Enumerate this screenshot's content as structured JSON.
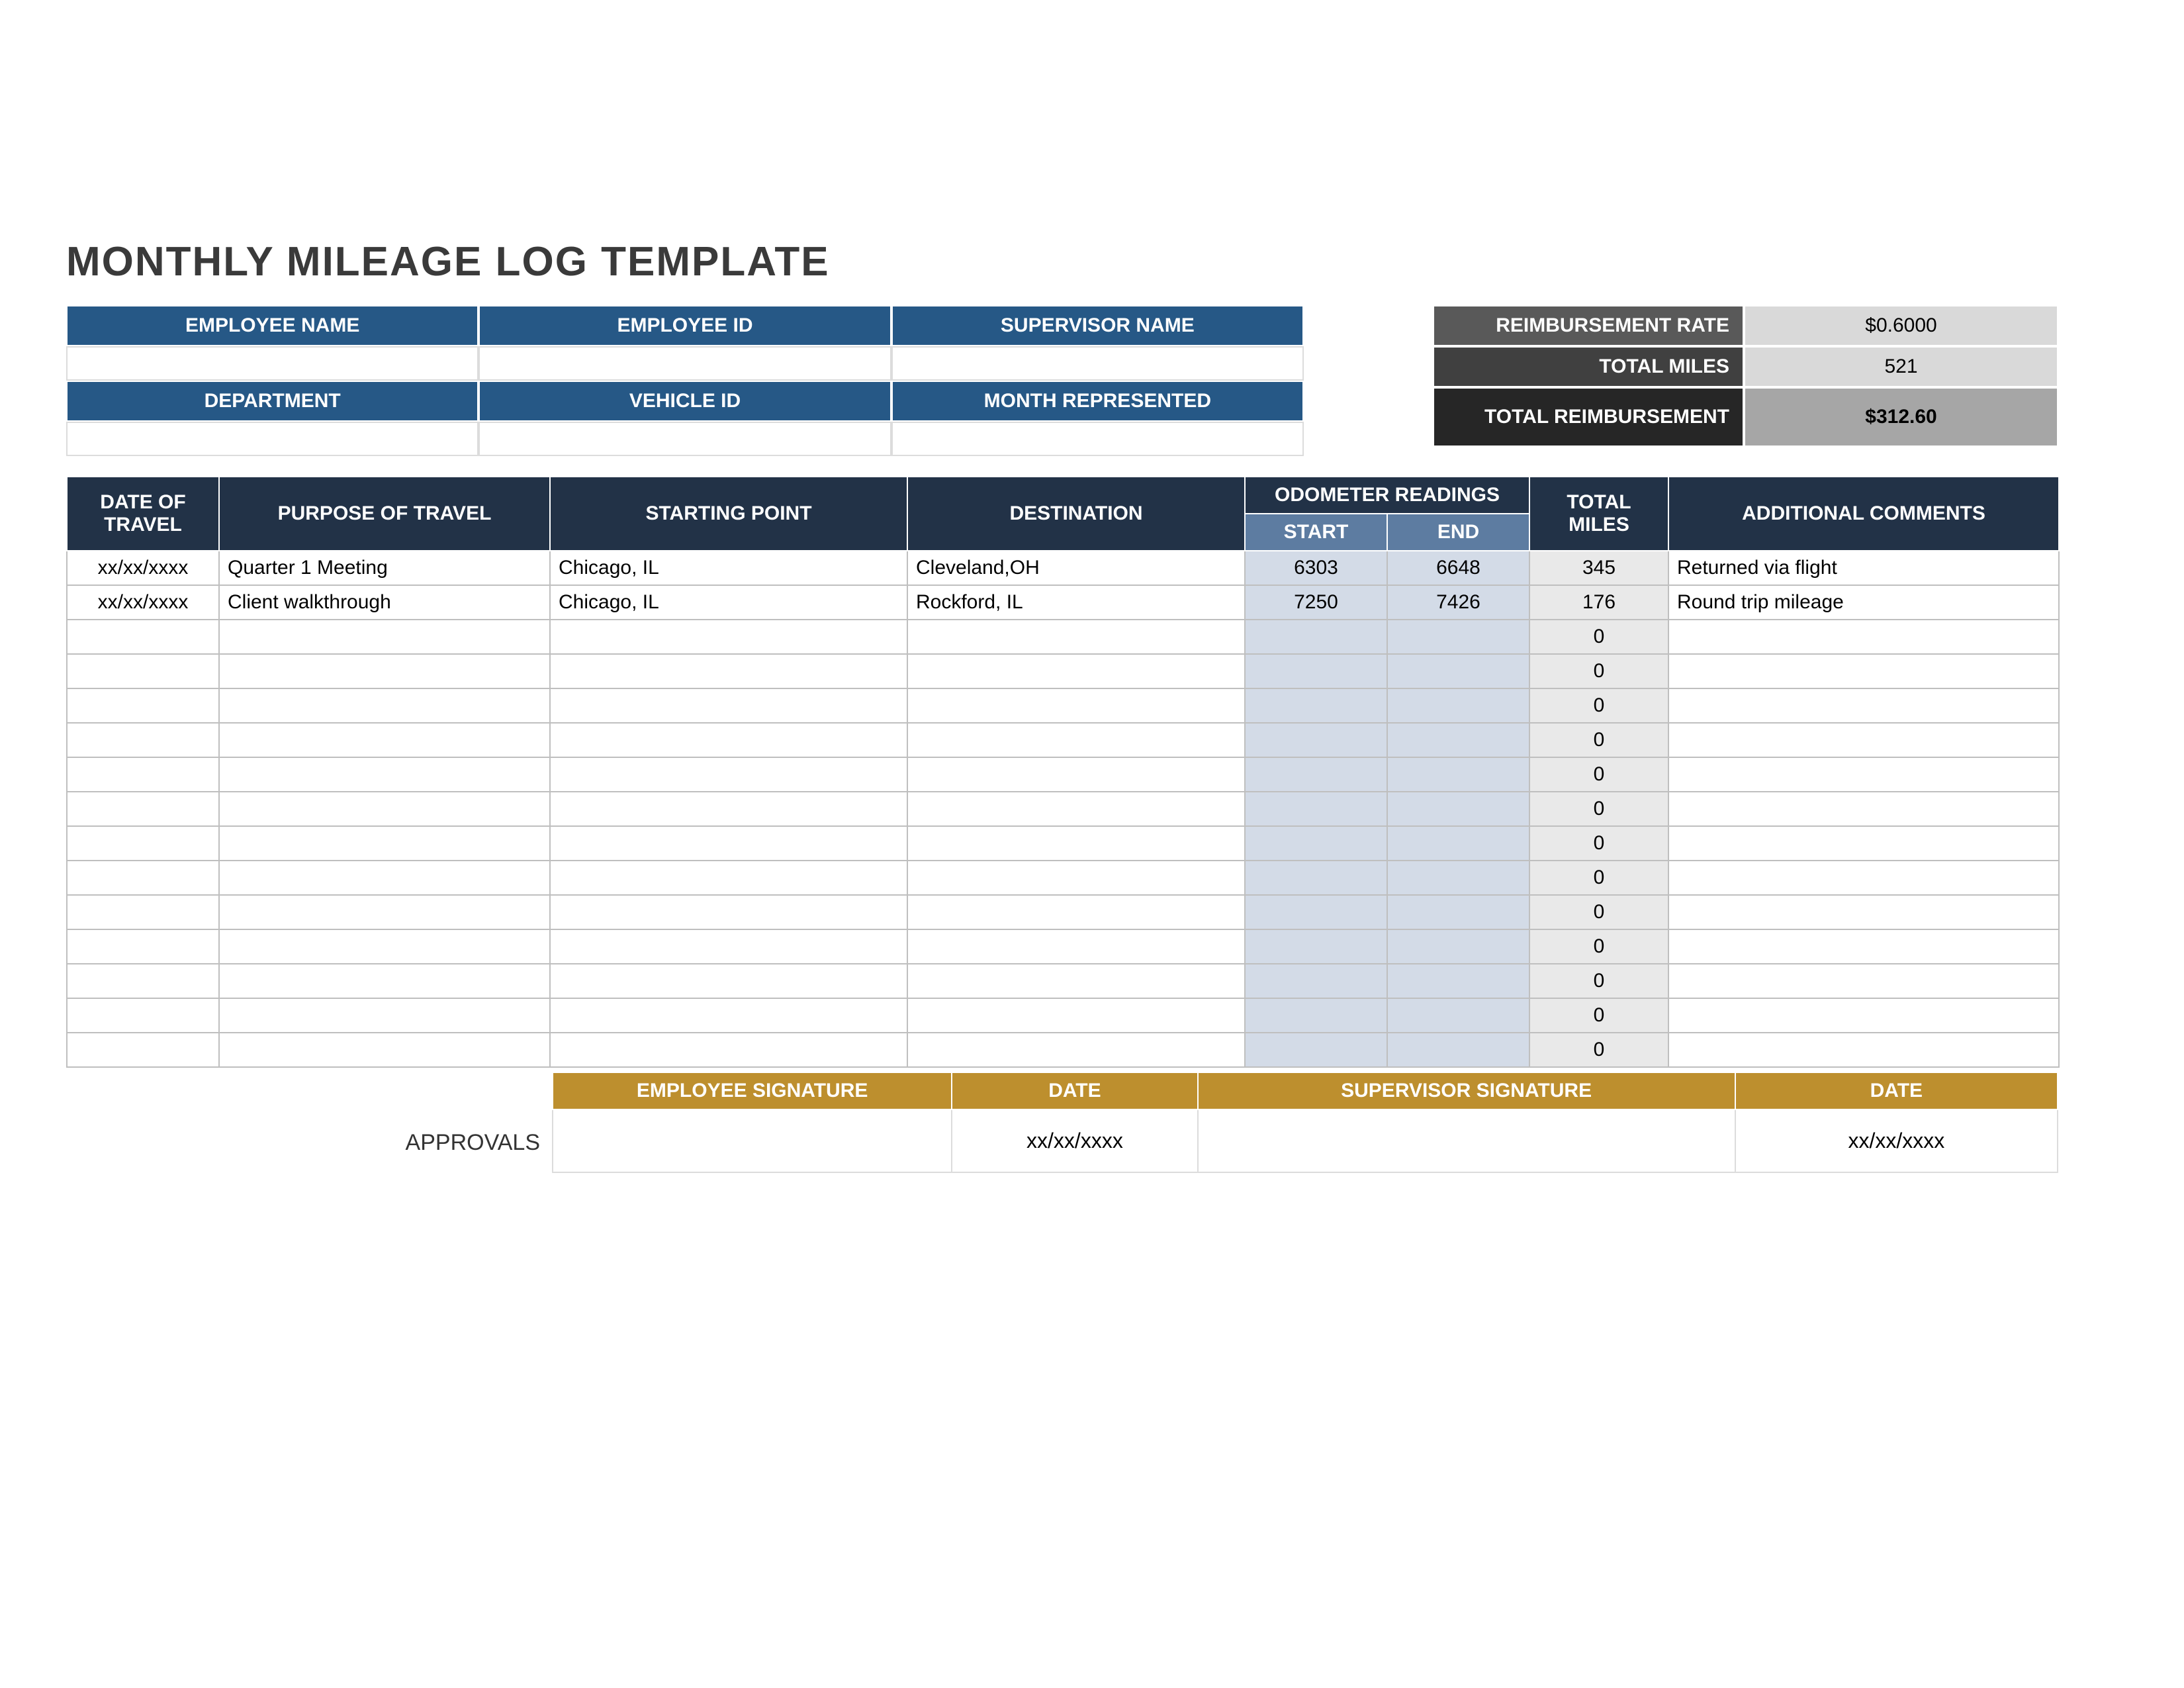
{
  "title": "MONTHLY MILEAGE LOG TEMPLATE",
  "info": {
    "row1": {
      "employee_name_label": "EMPLOYEE NAME",
      "employee_id_label": "EMPLOYEE ID",
      "supervisor_name_label": "SUPERVISOR NAME",
      "employee_name": "",
      "employee_id": "",
      "supervisor_name": ""
    },
    "row2": {
      "department_label": "DEPARTMENT",
      "vehicle_id_label": "VEHICLE ID",
      "month_label": "MONTH REPRESENTED",
      "department": "",
      "vehicle_id": "",
      "month": ""
    }
  },
  "summary": {
    "rate_label": "REIMBURSEMENT RATE",
    "rate_value": "$0.6000",
    "miles_label": "TOTAL MILES",
    "miles_value": "521",
    "total_label": "TOTAL REIMBURSEMENT",
    "total_value": "$312.60"
  },
  "columns": {
    "date": "DATE OF TRAVEL",
    "purpose": "PURPOSE OF TRAVEL",
    "starting": "STARTING POINT",
    "destination": "DESTINATION",
    "odometer": "ODOMETER READINGS",
    "ostart": "START",
    "oend": "END",
    "total": "TOTAL MILES",
    "comments": "ADDITIONAL COMMENTS"
  },
  "rows": [
    {
      "date": "xx/xx/xxxx",
      "purpose": "Quarter 1 Meeting",
      "starting": "Chicago, IL",
      "destination": "Cleveland,OH",
      "ostart": "6303",
      "oend": "6648",
      "total": "345",
      "comments": "Returned via flight"
    },
    {
      "date": "xx/xx/xxxx",
      "purpose": "Client walkthrough",
      "starting": "Chicago, IL",
      "destination": "Rockford, IL",
      "ostart": "7250",
      "oend": "7426",
      "total": "176",
      "comments": "Round trip mileage"
    },
    {
      "date": "",
      "purpose": "",
      "starting": "",
      "destination": "",
      "ostart": "",
      "oend": "",
      "total": "0",
      "comments": ""
    },
    {
      "date": "",
      "purpose": "",
      "starting": "",
      "destination": "",
      "ostart": "",
      "oend": "",
      "total": "0",
      "comments": ""
    },
    {
      "date": "",
      "purpose": "",
      "starting": "",
      "destination": "",
      "ostart": "",
      "oend": "",
      "total": "0",
      "comments": ""
    },
    {
      "date": "",
      "purpose": "",
      "starting": "",
      "destination": "",
      "ostart": "",
      "oend": "",
      "total": "0",
      "comments": ""
    },
    {
      "date": "",
      "purpose": "",
      "starting": "",
      "destination": "",
      "ostart": "",
      "oend": "",
      "total": "0",
      "comments": ""
    },
    {
      "date": "",
      "purpose": "",
      "starting": "",
      "destination": "",
      "ostart": "",
      "oend": "",
      "total": "0",
      "comments": ""
    },
    {
      "date": "",
      "purpose": "",
      "starting": "",
      "destination": "",
      "ostart": "",
      "oend": "",
      "total": "0",
      "comments": ""
    },
    {
      "date": "",
      "purpose": "",
      "starting": "",
      "destination": "",
      "ostart": "",
      "oend": "",
      "total": "0",
      "comments": ""
    },
    {
      "date": "",
      "purpose": "",
      "starting": "",
      "destination": "",
      "ostart": "",
      "oend": "",
      "total": "0",
      "comments": ""
    },
    {
      "date": "",
      "purpose": "",
      "starting": "",
      "destination": "",
      "ostart": "",
      "oend": "",
      "total": "0",
      "comments": ""
    },
    {
      "date": "",
      "purpose": "",
      "starting": "",
      "destination": "",
      "ostart": "",
      "oend": "",
      "total": "0",
      "comments": ""
    },
    {
      "date": "",
      "purpose": "",
      "starting": "",
      "destination": "",
      "ostart": "",
      "oend": "",
      "total": "0",
      "comments": ""
    },
    {
      "date": "",
      "purpose": "",
      "starting": "",
      "destination": "",
      "ostart": "",
      "oend": "",
      "total": "0",
      "comments": ""
    }
  ],
  "approvals": {
    "label": "APPROVALS",
    "emp_sig_label": "EMPLOYEE SIGNATURE",
    "emp_date_label": "DATE",
    "sup_sig_label": "SUPERVISOR SIGNATURE",
    "sup_date_label": "DATE",
    "emp_sig": "",
    "emp_date": "xx/xx/xxxx",
    "sup_sig": "",
    "sup_date": "xx/xx/xxxx"
  }
}
